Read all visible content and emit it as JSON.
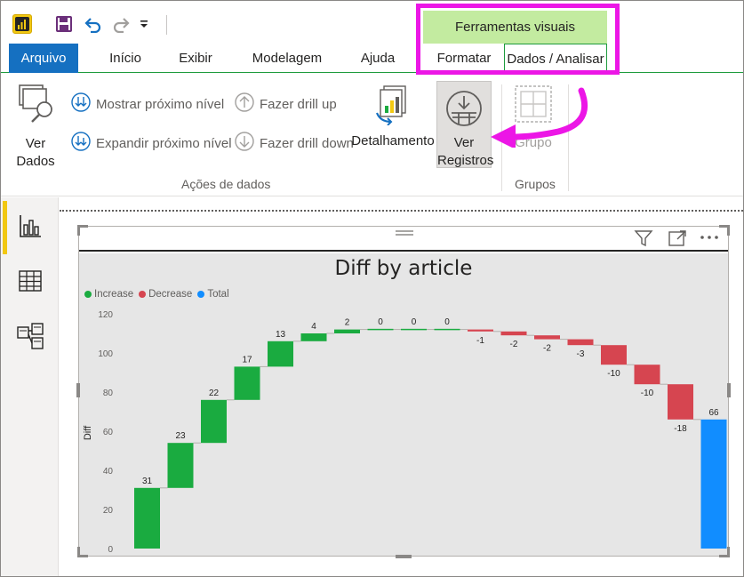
{
  "title_bar": {
    "app_icon": "power-bi-icon",
    "save_icon": "save-icon",
    "undo_icon": "undo-icon",
    "redo_icon": "redo-icon",
    "customize_icon": "dropdown-arrow-icon"
  },
  "context_tab": {
    "label": "Ferramentas visuais"
  },
  "tabs": [
    {
      "label": "Arquivo"
    },
    {
      "label": "Início"
    },
    {
      "label": "Exibir"
    },
    {
      "label": "Modelagem"
    },
    {
      "label": "Ajuda"
    },
    {
      "label": "Formatar"
    },
    {
      "label": "Dados / Analisar"
    }
  ],
  "ribbon": {
    "ver_dados": {
      "line1": "Ver",
      "line2": "Dados",
      "icon": "view-data-icon"
    },
    "mostrar_proximo": {
      "label": "Mostrar próximo nível",
      "icon": "go-next-level-icon"
    },
    "expandir_proximo": {
      "label": "Expandir próximo nível",
      "icon": "expand-next-level-icon"
    },
    "drill_up": {
      "label": "Fazer drill up",
      "icon": "drill-up-icon"
    },
    "drill_down": {
      "label": "Fazer drill down",
      "icon": "drill-down-icon"
    },
    "detalhamento": {
      "label": "Detalhamento",
      "icon": "drillthrough-icon"
    },
    "ver_registros": {
      "line1": "Ver",
      "line2": "Registros",
      "icon": "see-records-icon"
    },
    "grupo": {
      "label": "Grupo",
      "icon": "group-icon"
    },
    "group_acoes": "Ações de dados",
    "group_grupos": "Grupos"
  },
  "nav": [
    {
      "name": "report-view-icon",
      "active": true
    },
    {
      "name": "data-view-icon",
      "active": false
    },
    {
      "name": "model-view-icon",
      "active": false
    }
  ],
  "visual_header": {
    "filter_icon": "filter-icon",
    "focus_icon": "focus-mode-icon",
    "more_icon": "more-options-icon"
  },
  "colors": {
    "increase": "#1aab40",
    "decrease": "#d64550",
    "total": "#118dff",
    "highlight": "#ec16e6",
    "context": "#c3eba0",
    "file_tab": "#1570c1"
  },
  "chart_data": {
    "type": "waterfall",
    "title": "Diff by article",
    "ylabel": "Diff",
    "xlabel": "",
    "ylim": [
      0,
      120
    ],
    "yticks": [
      0,
      20,
      40,
      60,
      80,
      100,
      120
    ],
    "legend": [
      {
        "label": "Increase",
        "color": "#1aab40"
      },
      {
        "label": "Decrease",
        "color": "#d64550"
      },
      {
        "label": "Total",
        "color": "#118dff"
      }
    ],
    "legend_position": "top-left",
    "steps": [
      31,
      23,
      22,
      17,
      13,
      4,
      2,
      0,
      0,
      0,
      -1,
      -2,
      -2,
      -3,
      -10,
      -10,
      -18
    ],
    "labels": [
      "31",
      "23",
      "22",
      "17",
      "13",
      "4",
      "2",
      "0",
      "0",
      "0",
      "-1",
      "-2",
      "-2",
      "-3",
      "-10",
      "-10",
      "-18"
    ],
    "total": 66,
    "total_label": "66"
  }
}
